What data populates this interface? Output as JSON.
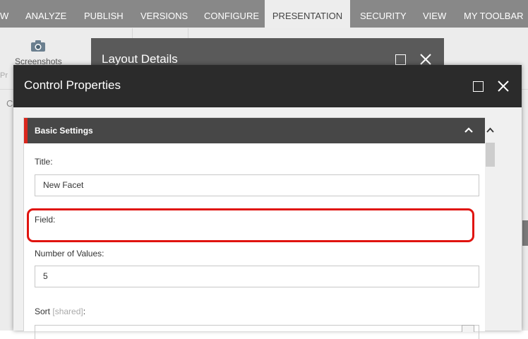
{
  "ribbon": {
    "tabs": [
      {
        "label": "W"
      },
      {
        "label": "ANALYZE"
      },
      {
        "label": "PUBLISH"
      },
      {
        "label": "VERSIONS"
      },
      {
        "label": "CONFIGURE"
      },
      {
        "label": "PRESENTATION",
        "active": true
      },
      {
        "label": "SECURITY"
      },
      {
        "label": "VIEW"
      },
      {
        "label": "MY TOOLBAR"
      }
    ],
    "screenshots_label": "Screenshots",
    "partial_pr": "Pr",
    "partial_c": "C"
  },
  "layout_dialog": {
    "title": "Layout Details"
  },
  "control_properties": {
    "title": "Control Properties",
    "section_title": "Basic Settings",
    "fields": {
      "title_label": "Title:",
      "title_value": "New Facet",
      "field_label": "Field:",
      "number_label": "Number of Values:",
      "number_value": "5",
      "sort_label": "Sort",
      "sort_shared": "[shared]",
      "sort_colon": ":"
    }
  },
  "colors": {
    "highlight": "#e0140f",
    "section_accent": "#d9261c",
    "ribbon": "#888888",
    "dialog_header": "#2b2b2b"
  }
}
